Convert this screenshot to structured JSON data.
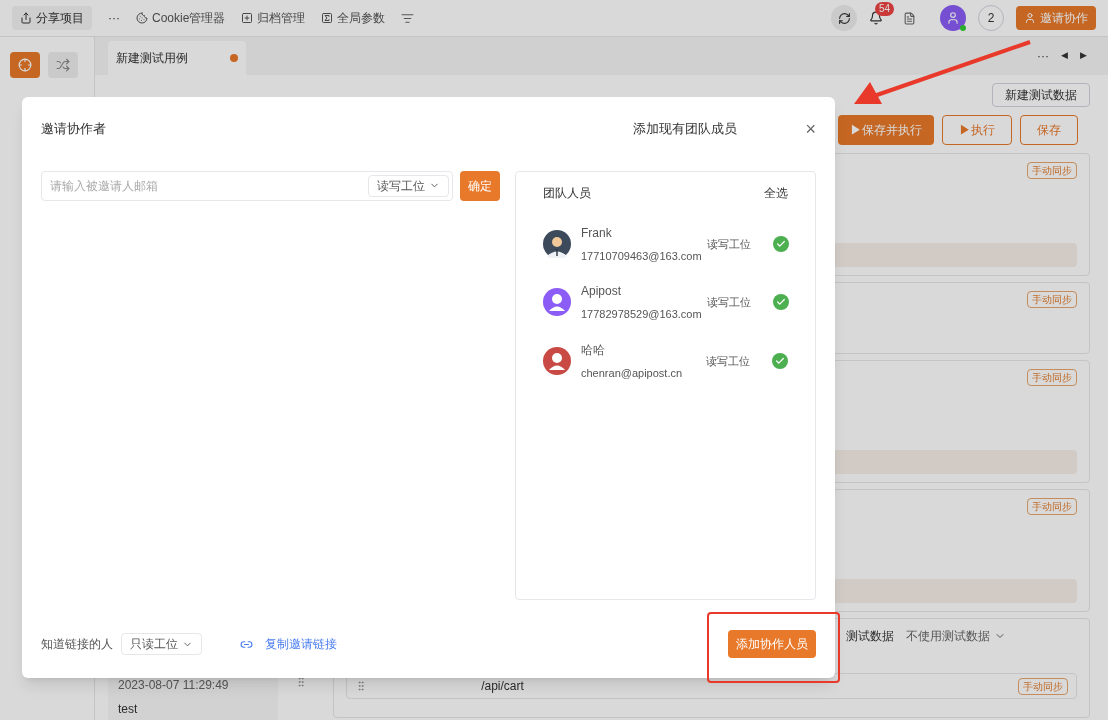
{
  "topbar": {
    "share": "分享项目",
    "more": "···",
    "menu": [
      {
        "kind": "cookie",
        "label": "Cookie管理器"
      },
      {
        "kind": "archive",
        "label": "归档管理"
      },
      {
        "kind": "params",
        "label": "全局参数"
      }
    ],
    "notifications": "54",
    "online_count": "2",
    "invite": "邀请协作"
  },
  "tabs": [
    {
      "label": "新建测试用例",
      "selected": true,
      "unsaved": true
    }
  ],
  "tab_nav": "···",
  "tab_prev": "◀",
  "tab_next": "▶",
  "toolbar": {
    "new_data": "新建测试数据",
    "save_run": "▶保存并执行",
    "run": "▶执行",
    "save": "保存"
  },
  "sync_tags": [
    "手动同步",
    "手动同步",
    "手动同步",
    "手动同步",
    "手动同步"
  ],
  "test_data": {
    "label": "测试数据",
    "value": "不使用测试数据"
  },
  "history": {
    "time": "2023-08-07 11:29:49",
    "name": "test"
  },
  "step": {
    "url": "/api/cart"
  },
  "dialog": {
    "title": "邀请协作者",
    "email_placeholder": "请输入被邀请人邮箱",
    "role": "读写工位",
    "confirm": "确定",
    "team_title": "添加现有团队成员",
    "close": "×",
    "team_header": "团队人员",
    "select_all": "全选",
    "members": [
      {
        "name": "Frank",
        "email": "17710709463@163.com",
        "role": "读写工位",
        "selected": true,
        "kind": "photo",
        "color": "#3d4a5c"
      },
      {
        "name": "Apipost",
        "email": "17782978529@163.com",
        "role": "读写工位",
        "selected": true,
        "kind": "person",
        "color": "#8b5cf6"
      },
      {
        "name": "哈哈",
        "email": "chenran@apipost.cn",
        "role": "读写工位",
        "selected": true,
        "kind": "person",
        "color": "#c94a44"
      }
    ],
    "link_label": "知道链接的人",
    "link_role": "只读工位",
    "copy_link": "复制邀请链接",
    "add": "添加协作人员"
  }
}
